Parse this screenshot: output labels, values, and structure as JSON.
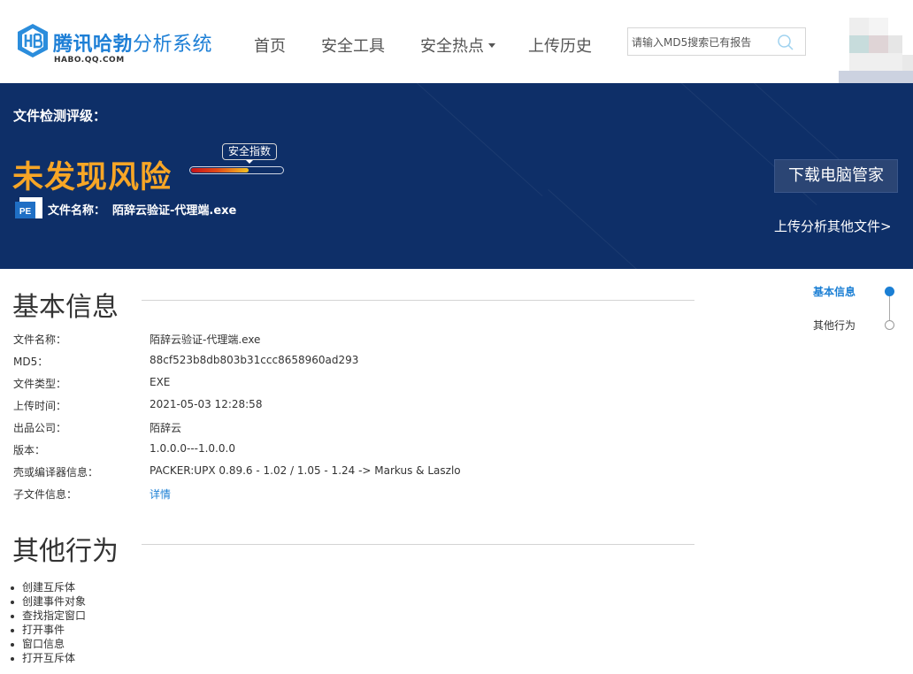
{
  "header": {
    "logo_title_strong": "腾讯哈勃",
    "logo_title_light": "分析系统",
    "logo_domain": "HABO.QQ.COM",
    "nav": [
      {
        "label": "首页"
      },
      {
        "label": "安全工具"
      },
      {
        "label": "安全热点",
        "has_dropdown": true
      },
      {
        "label": "上传历史"
      }
    ],
    "search": {
      "placeholder": "请输入MD5搜索已有报告",
      "value": ""
    },
    "brand_color": "#1d7fd6"
  },
  "banner": {
    "level_label": "文件检测评级：",
    "risk_text": "未发现风险",
    "meter_label": "安全指数",
    "meter_level": 0.63,
    "file_icon_text": "PE",
    "file_label": "文件名称：",
    "file_name": "陌辞云验证-代理端.exe",
    "download_button": "下载电脑管家",
    "upload_link": "上传分析其他文件>",
    "background_color": "#0e2f68",
    "risk_color": "#f7a626"
  },
  "basic_info": {
    "title": "基本信息",
    "rows": [
      {
        "key": "文件名称：",
        "value": "陌辞云验证-代理端.exe"
      },
      {
        "key": "MD5：",
        "value": "88cf523b8db803b31ccc8658960ad293"
      },
      {
        "key": "文件类型：",
        "value": "EXE"
      },
      {
        "key": "上传时间：",
        "value": "2021-05-03 12:28:58"
      },
      {
        "key": "出品公司：",
        "value": "陌辞云"
      },
      {
        "key": "版本：",
        "value": "1.0.0.0---1.0.0.0"
      },
      {
        "key": "壳或编译器信息：",
        "value": "PACKER:UPX 0.89.6 - 1.02 / 1.05 - 1.24 -> Markus & Laszlo"
      },
      {
        "key": "子文件信息：",
        "value": "详情",
        "is_link": true
      }
    ]
  },
  "other_behaviors": {
    "title": "其他行为",
    "items": [
      "创建互斥体",
      "创建事件对象",
      "查找指定窗口",
      "打开事件",
      "窗口信息",
      "打开互斥体"
    ]
  },
  "side_nav": {
    "items": [
      {
        "label": "基本信息",
        "active": true
      },
      {
        "label": "其他行为",
        "active": false
      }
    ],
    "active_color": "#1b7fd4"
  }
}
